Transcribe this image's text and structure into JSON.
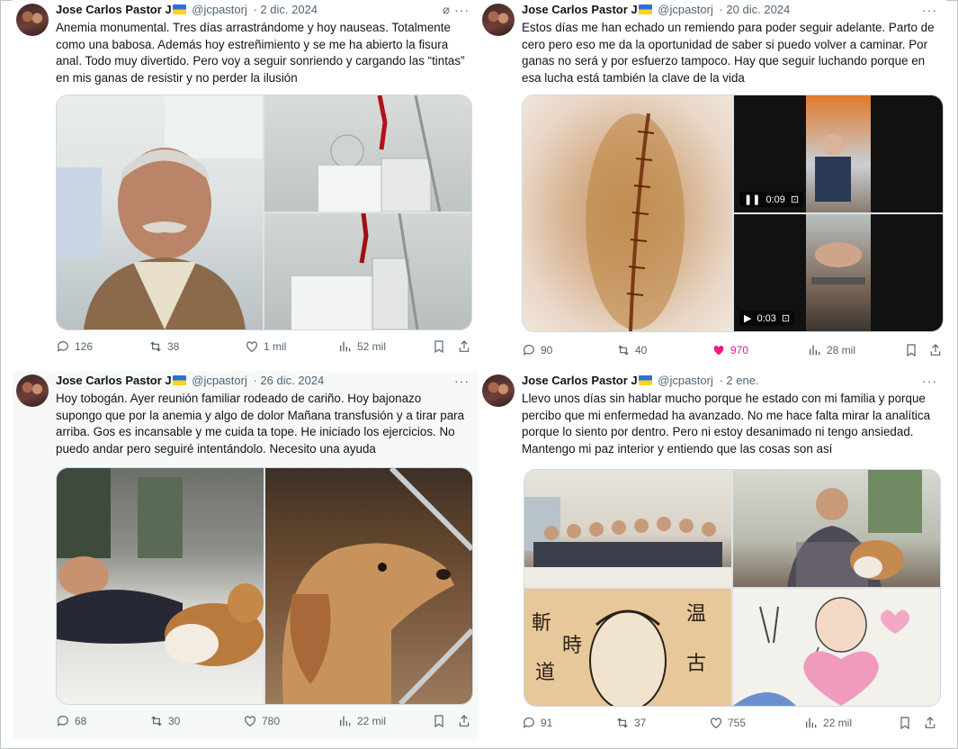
{
  "tweets": [
    {
      "author": "Jose Carlos Pastor J",
      "handle": "@jcpastorj",
      "date": "· 2 dic. 2024",
      "text": "Anemia monumental. Tres días arrastrándome y hoy nauseas. Totalmente como una babosa. Además hoy estreñimiento y se me ha abierto la fisura anal. Todo muy divertido. Pero voy a seguir sonriendo y cargando las “tintas” en mis ganas de resistir y no perder la ilusión",
      "replies": "126",
      "reposts": "38",
      "likes": "1 mil",
      "views": "52 mil"
    },
    {
      "author": "Jose Carlos Pastor J",
      "handle": "@jcpastorj",
      "date": "· 20 dic. 2024",
      "text": "Estos días me han echado un remiendo para poder seguir adelante. Parto de cero pero eso me da la oportunidad de saber si puedo volver a caminar. Por ganas no será y por esfuerzo tampoco. Hay que seguir luchando porque en esa lucha está también la clave de la vida",
      "video1_time": "0:09",
      "video2_time": "0:03",
      "replies": "90",
      "reposts": "40",
      "likes": "970",
      "views": "28 mil"
    },
    {
      "author": "Jose Carlos Pastor J",
      "handle": "@jcpastorj",
      "date": "· 26 dic. 2024",
      "text": "Hoy tobogán. Ayer reunión familiar rodeado de cariño. Hoy bajonazo supongo que por la anemia y algo de dolor Mañana transfusión y a tirar para arriba. Gos es incansable y me cuida ta tope. He iniciado los ejercicios. No puedo andar pero seguiré  intentándolo. Necesito una ayuda",
      "replies": "68",
      "reposts": "30",
      "likes": "780",
      "views": "22 mil"
    },
    {
      "author": "Jose Carlos Pastor J",
      "handle": "@jcpastorj",
      "date": "· 2 ene.",
      "text": "Llevo unos días sin hablar mucho porque he estado con mi familia y porque percibo que mi enfermedad ha avanzado. No me hace falta mirar la analítica porque lo siento por dentro. Pero ni estoy desanimado ni tengo ansiedad. Mantengo mi paz interior y entiendo que las cosas son así",
      "replies": "91",
      "reposts": "37",
      "likes": "755",
      "views": "22 mil"
    }
  ],
  "colors": {
    "text": "#0f1419",
    "muted": "#536471",
    "like": "#f91880",
    "border": "#cfd9de"
  },
  "icons": [
    "reply-icon",
    "repost-icon",
    "like-icon",
    "views-icon",
    "bookmark-icon",
    "share-icon",
    "more-icon",
    "grok-icon",
    "flag-icon"
  ]
}
